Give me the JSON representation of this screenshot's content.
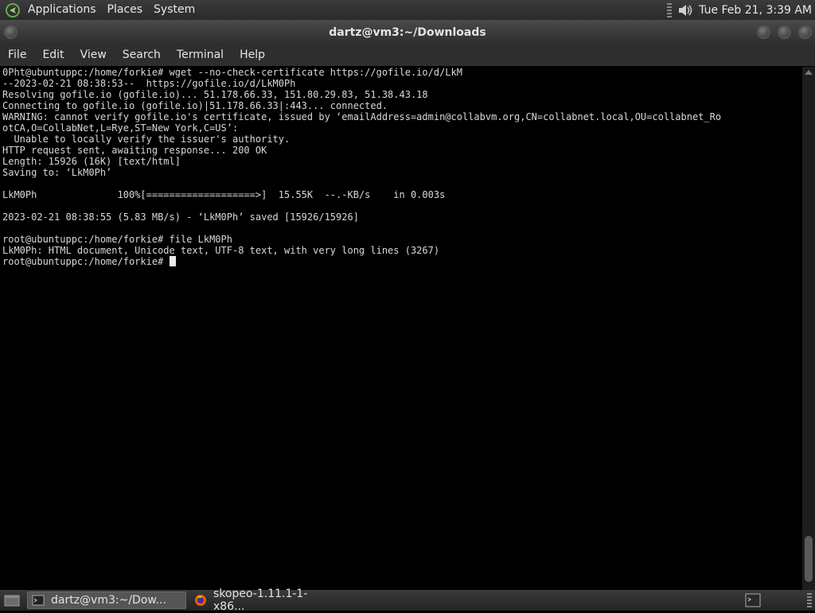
{
  "top_panel": {
    "menus": [
      "Applications",
      "Places",
      "System"
    ],
    "clock": "Tue Feb 21,  3:39 AM"
  },
  "window": {
    "title": "dartz@vm3:~/Downloads",
    "menus": [
      "File",
      "Edit",
      "View",
      "Search",
      "Terminal",
      "Help"
    ]
  },
  "terminal": {
    "lines": [
      "0Pht@ubuntuppc:/home/forkie# wget --no-check-certificate https://gofile.io/d/LkM",
      "--2023-02-21 08:38:53--  https://gofile.io/d/LkM0Ph",
      "Resolving gofile.io (gofile.io)... 51.178.66.33, 151.80.29.83, 51.38.43.18",
      "Connecting to gofile.io (gofile.io)|51.178.66.33|:443... connected.",
      "WARNING: cannot verify gofile.io's certificate, issued by ‘emailAddress=admin@collabvm.org,CN=collabnet.local,OU=collabnet_Ro",
      "otCA,O=CollabNet,L=Rye,ST=New York,C=US’:",
      "  Unable to locally verify the issuer's authority.",
      "HTTP request sent, awaiting response... 200 OK",
      "Length: 15926 (16K) [text/html]",
      "Saving to: ‘LkM0Ph’",
      "",
      "LkM0Ph              100%[===================>]  15.55K  --.-KB/s    in 0.003s",
      "",
      "2023-02-21 08:38:55 (5.83 MB/s) - ‘LkM0Ph’ saved [15926/15926]",
      "",
      "root@ubuntuppc:/home/forkie# file LkM0Ph",
      "LkM0Ph: HTML document, Unicode text, UTF-8 text, with very long lines (3267)"
    ],
    "prompt": "root@ubuntuppc:/home/forkie# "
  },
  "taskbar": {
    "tasks": [
      {
        "label": "dartz@vm3:~/Dow...",
        "icon": "terminal-icon",
        "active": true
      },
      {
        "label": "skopeo-1.11.1-1-x86...",
        "icon": "firefox-icon",
        "active": false
      }
    ]
  },
  "colors": {
    "panel": "#2e2e2e",
    "terminal_bg": "#000000",
    "terminal_fg": "#d8d8d8"
  }
}
